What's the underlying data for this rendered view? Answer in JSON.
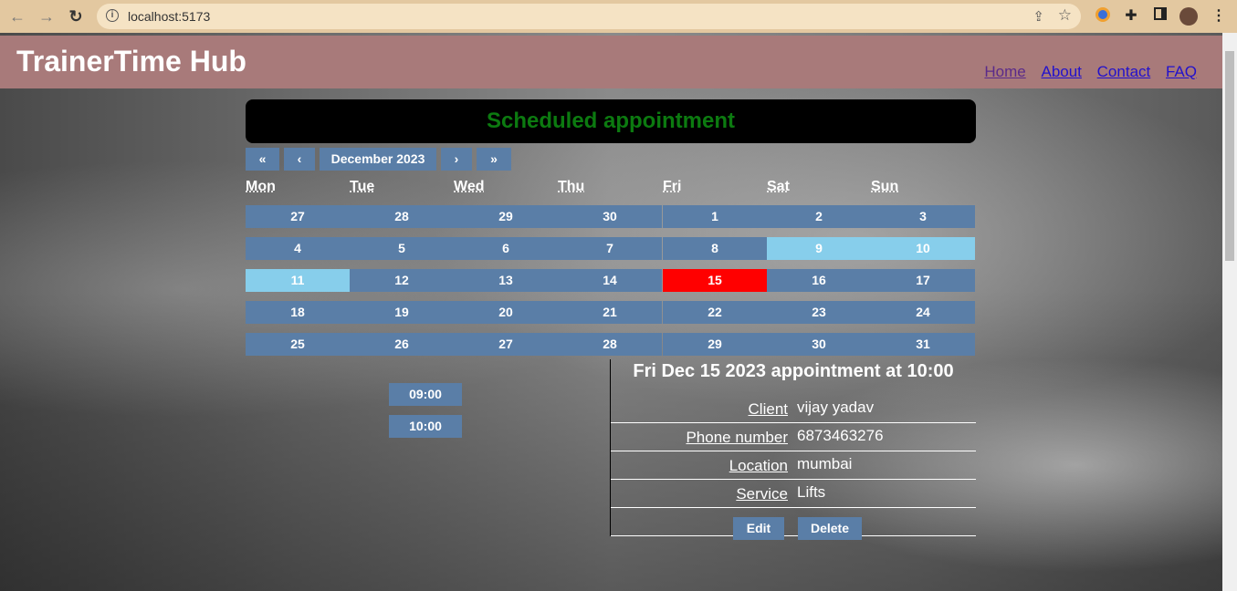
{
  "browser": {
    "url": "localhost:5173",
    "icons": [
      "back-icon",
      "forward-icon",
      "reload-icon",
      "info-icon",
      "share-icon",
      "star-icon",
      "extension-icon",
      "puzzle-icon",
      "sidepanel-icon",
      "profile-avatar",
      "menu-icon"
    ]
  },
  "header": {
    "brand": "TrainerTime Hub",
    "nav": [
      "Home",
      "About",
      "Contact",
      "FAQ"
    ]
  },
  "title": "Scheduled appointment",
  "calendar": {
    "nav": {
      "first": "«",
      "prev": "‹",
      "month": "December 2023",
      "next": "›",
      "last": "»"
    },
    "weekdays": [
      "Mon",
      "Tue",
      "Wed",
      "Thu",
      "Fri",
      "Sat",
      "Sun"
    ],
    "weeks": [
      [
        "27",
        "28",
        "29",
        "30",
        "1",
        "2",
        "3"
      ],
      [
        "4",
        "5",
        "6",
        "7",
        "8",
        "9",
        "10"
      ],
      [
        "11",
        "12",
        "13",
        "14",
        "15",
        "16",
        "17"
      ],
      [
        "18",
        "19",
        "20",
        "21",
        "22",
        "23",
        "24"
      ],
      [
        "25",
        "26",
        "27",
        "28",
        "29",
        "30",
        "31"
      ]
    ],
    "highlighted_days": [
      "9",
      "10",
      "11"
    ],
    "selected_day": "15",
    "colors": {
      "tile": "#5a7ea7",
      "highlight": "#87ceeb",
      "selected": "#ff0000"
    }
  },
  "slots": [
    "09:00",
    "10:00"
  ],
  "details": {
    "heading": "Fri Dec 15 2023  appointment at 10:00",
    "rows": [
      {
        "label": "Client",
        "value": "vijay yadav"
      },
      {
        "label": "Phone number",
        "value": "6873463276"
      },
      {
        "label": "Location",
        "value": "mumbai"
      },
      {
        "label": "Service",
        "value": "Lifts"
      }
    ],
    "edit_label": "Edit",
    "delete_label": "Delete"
  }
}
